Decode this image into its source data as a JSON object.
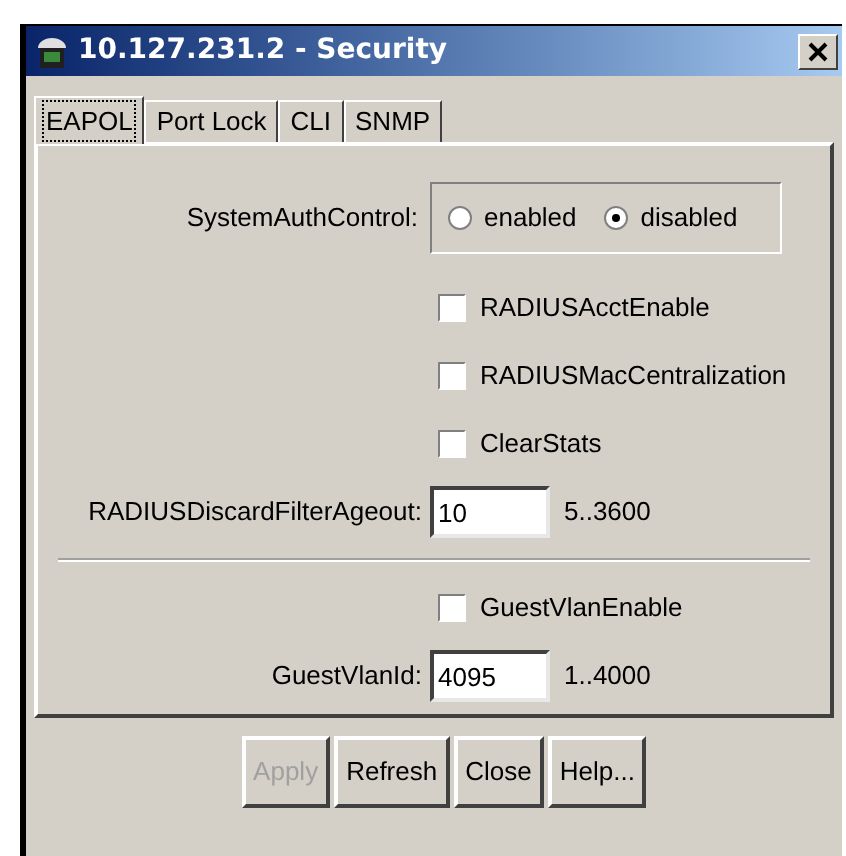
{
  "window": {
    "title": "10.127.231.2 - Security"
  },
  "tabs": [
    {
      "label": "EAPOL",
      "selected": true
    },
    {
      "label": "Port Lock",
      "selected": false
    },
    {
      "label": "CLI",
      "selected": false
    },
    {
      "label": "SNMP",
      "selected": false
    }
  ],
  "rows": [
    {
      "kind": "radio",
      "label": "SystemAuthControl:",
      "options": [
        {
          "label": "enabled",
          "selected": false
        },
        {
          "label": "disabled",
          "selected": true
        }
      ]
    },
    {
      "kind": "checkbox",
      "label": "RADIUSAcctEnable",
      "checked": false
    },
    {
      "kind": "checkbox",
      "label": "RADIUSMacCentralization",
      "checked": false
    },
    {
      "kind": "checkbox",
      "label": "ClearStats",
      "checked": false
    },
    {
      "kind": "number",
      "label": "RADIUSDiscardFilterAgeout:",
      "value": "10",
      "range": "5..3600"
    },
    {
      "kind": "divider"
    },
    {
      "kind": "checkbox",
      "label": "GuestVlanEnable",
      "checked": false
    },
    {
      "kind": "number",
      "label": "GuestVlanId:",
      "value": "4095",
      "range": "1..4000"
    }
  ],
  "buttons": [
    {
      "label": "Apply",
      "disabled": true
    },
    {
      "label": "Refresh",
      "disabled": false
    },
    {
      "label": "Close",
      "disabled": false
    },
    {
      "label": "Help...",
      "disabled": false
    }
  ]
}
